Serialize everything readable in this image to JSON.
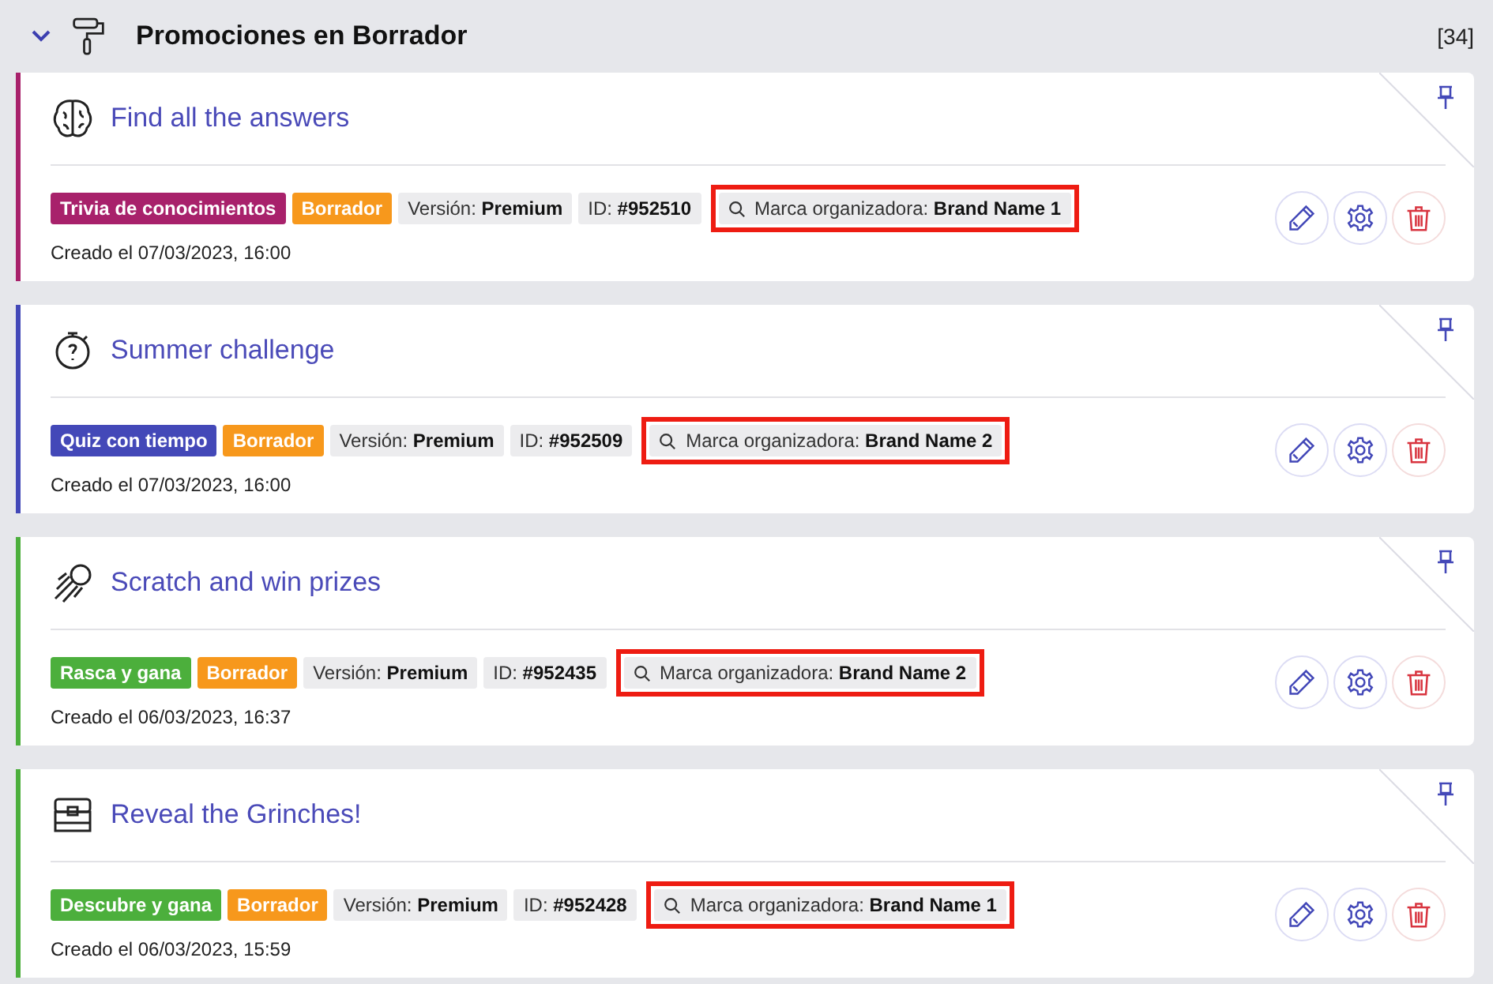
{
  "section": {
    "title": "Promociones en Borrador",
    "count": "[34]",
    "expanded": true
  },
  "promotions": [
    {
      "kind": "brain",
      "title": "Find all the answers",
      "type": "Trivia de conocimientos",
      "color": "#a8216b",
      "status": "Borrador",
      "version_label": "Versión:",
      "version": "Premium",
      "id_label": "ID:",
      "id": "#952510",
      "brand_label": "Marca organizadora:",
      "brand": "Brand Name 1",
      "highlighted": true,
      "created": "Creado el 07/03/2023, 16:00"
    },
    {
      "kind": "stopwatch",
      "title": "Summer challenge",
      "type": "Quiz con tiempo",
      "color": "#4348b8",
      "status": "Borrador",
      "version_label": "Versión:",
      "version": "Premium",
      "id_label": "ID:",
      "id": "#952509",
      "brand_label": "Marca organizadora:",
      "brand": "Brand Name 2",
      "highlighted": true,
      "created": "Creado el 07/03/2023, 16:00"
    },
    {
      "kind": "comet",
      "title": "Scratch and win prizes",
      "type": "Rasca y gana",
      "color": "#4caf3c",
      "status": "Borrador",
      "version_label": "Versión:",
      "version": "Premium",
      "id_label": "ID:",
      "id": "#952435",
      "brand_label": "Marca organizadora:",
      "brand": "Brand Name 2",
      "highlighted": true,
      "created": "Creado el 06/03/2023, 16:37"
    },
    {
      "kind": "chest",
      "title": "Reveal the Grinches!",
      "type": "Descubre y gana",
      "color": "#4caf3c",
      "status": "Borrador",
      "version_label": "Versión:",
      "version": "Premium",
      "id_label": "ID:",
      "id": "#952428",
      "brand_label": "Marca organizadora:",
      "brand": "Brand Name 1",
      "highlighted": true,
      "created": "Creado el 06/03/2023, 15:59"
    }
  ]
}
